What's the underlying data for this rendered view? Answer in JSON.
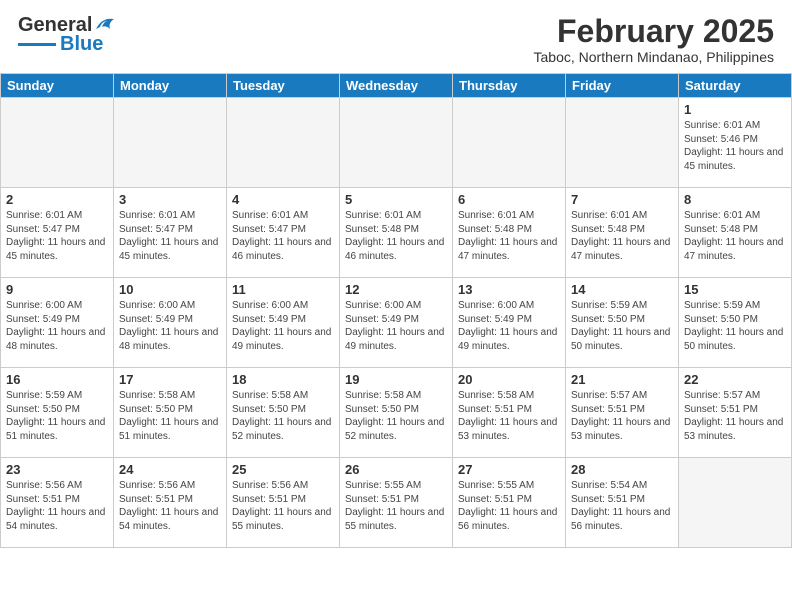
{
  "header": {
    "logo_general": "General",
    "logo_blue": "Blue",
    "month": "February 2025",
    "location": "Taboc, Northern Mindanao, Philippines"
  },
  "weekdays": [
    "Sunday",
    "Monday",
    "Tuesday",
    "Wednesday",
    "Thursday",
    "Friday",
    "Saturday"
  ],
  "weeks": [
    [
      {
        "day": "",
        "empty": true
      },
      {
        "day": "",
        "empty": true
      },
      {
        "day": "",
        "empty": true
      },
      {
        "day": "",
        "empty": true
      },
      {
        "day": "",
        "empty": true
      },
      {
        "day": "",
        "empty": true
      },
      {
        "day": "1",
        "sunrise": "6:01 AM",
        "sunset": "5:46 PM",
        "daylight": "11 hours and 45 minutes."
      }
    ],
    [
      {
        "day": "2",
        "sunrise": "6:01 AM",
        "sunset": "5:47 PM",
        "daylight": "11 hours and 45 minutes."
      },
      {
        "day": "3",
        "sunrise": "6:01 AM",
        "sunset": "5:47 PM",
        "daylight": "11 hours and 45 minutes."
      },
      {
        "day": "4",
        "sunrise": "6:01 AM",
        "sunset": "5:47 PM",
        "daylight": "11 hours and 46 minutes."
      },
      {
        "day": "5",
        "sunrise": "6:01 AM",
        "sunset": "5:48 PM",
        "daylight": "11 hours and 46 minutes."
      },
      {
        "day": "6",
        "sunrise": "6:01 AM",
        "sunset": "5:48 PM",
        "daylight": "11 hours and 47 minutes."
      },
      {
        "day": "7",
        "sunrise": "6:01 AM",
        "sunset": "5:48 PM",
        "daylight": "11 hours and 47 minutes."
      },
      {
        "day": "8",
        "sunrise": "6:01 AM",
        "sunset": "5:48 PM",
        "daylight": "11 hours and 47 minutes."
      }
    ],
    [
      {
        "day": "9",
        "sunrise": "6:00 AM",
        "sunset": "5:49 PM",
        "daylight": "11 hours and 48 minutes."
      },
      {
        "day": "10",
        "sunrise": "6:00 AM",
        "sunset": "5:49 PM",
        "daylight": "11 hours and 48 minutes."
      },
      {
        "day": "11",
        "sunrise": "6:00 AM",
        "sunset": "5:49 PM",
        "daylight": "11 hours and 49 minutes."
      },
      {
        "day": "12",
        "sunrise": "6:00 AM",
        "sunset": "5:49 PM",
        "daylight": "11 hours and 49 minutes."
      },
      {
        "day": "13",
        "sunrise": "6:00 AM",
        "sunset": "5:49 PM",
        "daylight": "11 hours and 49 minutes."
      },
      {
        "day": "14",
        "sunrise": "5:59 AM",
        "sunset": "5:50 PM",
        "daylight": "11 hours and 50 minutes."
      },
      {
        "day": "15",
        "sunrise": "5:59 AM",
        "sunset": "5:50 PM",
        "daylight": "11 hours and 50 minutes."
      }
    ],
    [
      {
        "day": "16",
        "sunrise": "5:59 AM",
        "sunset": "5:50 PM",
        "daylight": "11 hours and 51 minutes."
      },
      {
        "day": "17",
        "sunrise": "5:58 AM",
        "sunset": "5:50 PM",
        "daylight": "11 hours and 51 minutes."
      },
      {
        "day": "18",
        "sunrise": "5:58 AM",
        "sunset": "5:50 PM",
        "daylight": "11 hours and 52 minutes."
      },
      {
        "day": "19",
        "sunrise": "5:58 AM",
        "sunset": "5:50 PM",
        "daylight": "11 hours and 52 minutes."
      },
      {
        "day": "20",
        "sunrise": "5:58 AM",
        "sunset": "5:51 PM",
        "daylight": "11 hours and 53 minutes."
      },
      {
        "day": "21",
        "sunrise": "5:57 AM",
        "sunset": "5:51 PM",
        "daylight": "11 hours and 53 minutes."
      },
      {
        "day": "22",
        "sunrise": "5:57 AM",
        "sunset": "5:51 PM",
        "daylight": "11 hours and 53 minutes."
      }
    ],
    [
      {
        "day": "23",
        "sunrise": "5:56 AM",
        "sunset": "5:51 PM",
        "daylight": "11 hours and 54 minutes."
      },
      {
        "day": "24",
        "sunrise": "5:56 AM",
        "sunset": "5:51 PM",
        "daylight": "11 hours and 54 minutes."
      },
      {
        "day": "25",
        "sunrise": "5:56 AM",
        "sunset": "5:51 PM",
        "daylight": "11 hours and 55 minutes."
      },
      {
        "day": "26",
        "sunrise": "5:55 AM",
        "sunset": "5:51 PM",
        "daylight": "11 hours and 55 minutes."
      },
      {
        "day": "27",
        "sunrise": "5:55 AM",
        "sunset": "5:51 PM",
        "daylight": "11 hours and 56 minutes."
      },
      {
        "day": "28",
        "sunrise": "5:54 AM",
        "sunset": "5:51 PM",
        "daylight": "11 hours and 56 minutes."
      },
      {
        "day": "",
        "empty": true
      }
    ]
  ]
}
